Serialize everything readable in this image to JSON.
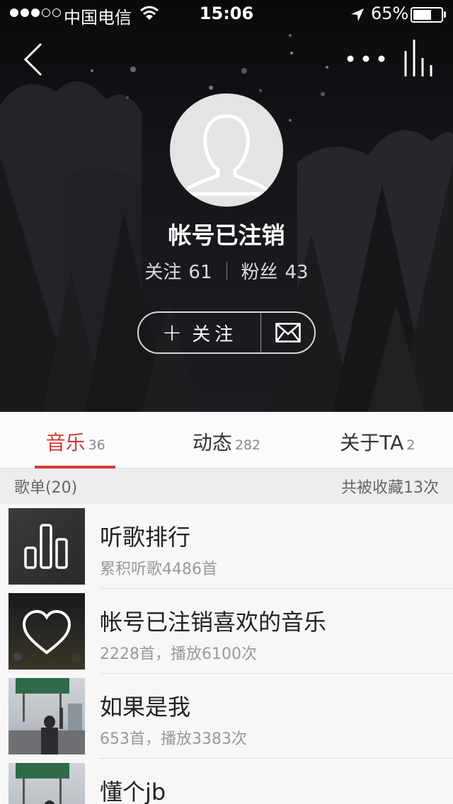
{
  "status_bar": {
    "carrier": "中国电信",
    "time": "15:06",
    "battery_percent": "65%",
    "battery_level": 0.65,
    "signal_bars_filled": 3,
    "signal_bars_total": 5
  },
  "header": {
    "back_icon": "chevron-left-icon",
    "more_icon": "more-dots-icon",
    "now_playing_icon": "now-playing-bars-icon"
  },
  "profile": {
    "username": "帐号已注销",
    "following_label": "关注",
    "following_count": "61",
    "followers_label": "粉丝",
    "followers_count": "43",
    "follow_button_plus": "+",
    "follow_button_label": "关注",
    "message_icon": "envelope-icon"
  },
  "tabs": [
    {
      "label": "音乐",
      "count": "36",
      "active": true
    },
    {
      "label": "动态",
      "count": "282",
      "active": false
    },
    {
      "label": "关于TA",
      "count": "2",
      "active": false
    }
  ],
  "section": {
    "title": "歌单(20)",
    "subtitle": "共被收藏13次"
  },
  "playlists": [
    {
      "title": "听歌排行",
      "subtitle": "累积听歌4486首",
      "cover_icon": "ranking-bars-icon"
    },
    {
      "title": "帐号已注销喜欢的音乐",
      "subtitle": "2228首，播放6100次",
      "cover_icon": "heart-icon"
    },
    {
      "title": "如果是我",
      "subtitle": "653首，播放3383次",
      "cover_icon": "street-photo"
    },
    {
      "title": "懂个jb",
      "subtitle": "",
      "cover_icon": "street-photo"
    }
  ],
  "colors": {
    "accent": "#d33a31",
    "header_bg": "#15161a",
    "page_bg": "#f7f7f7"
  }
}
